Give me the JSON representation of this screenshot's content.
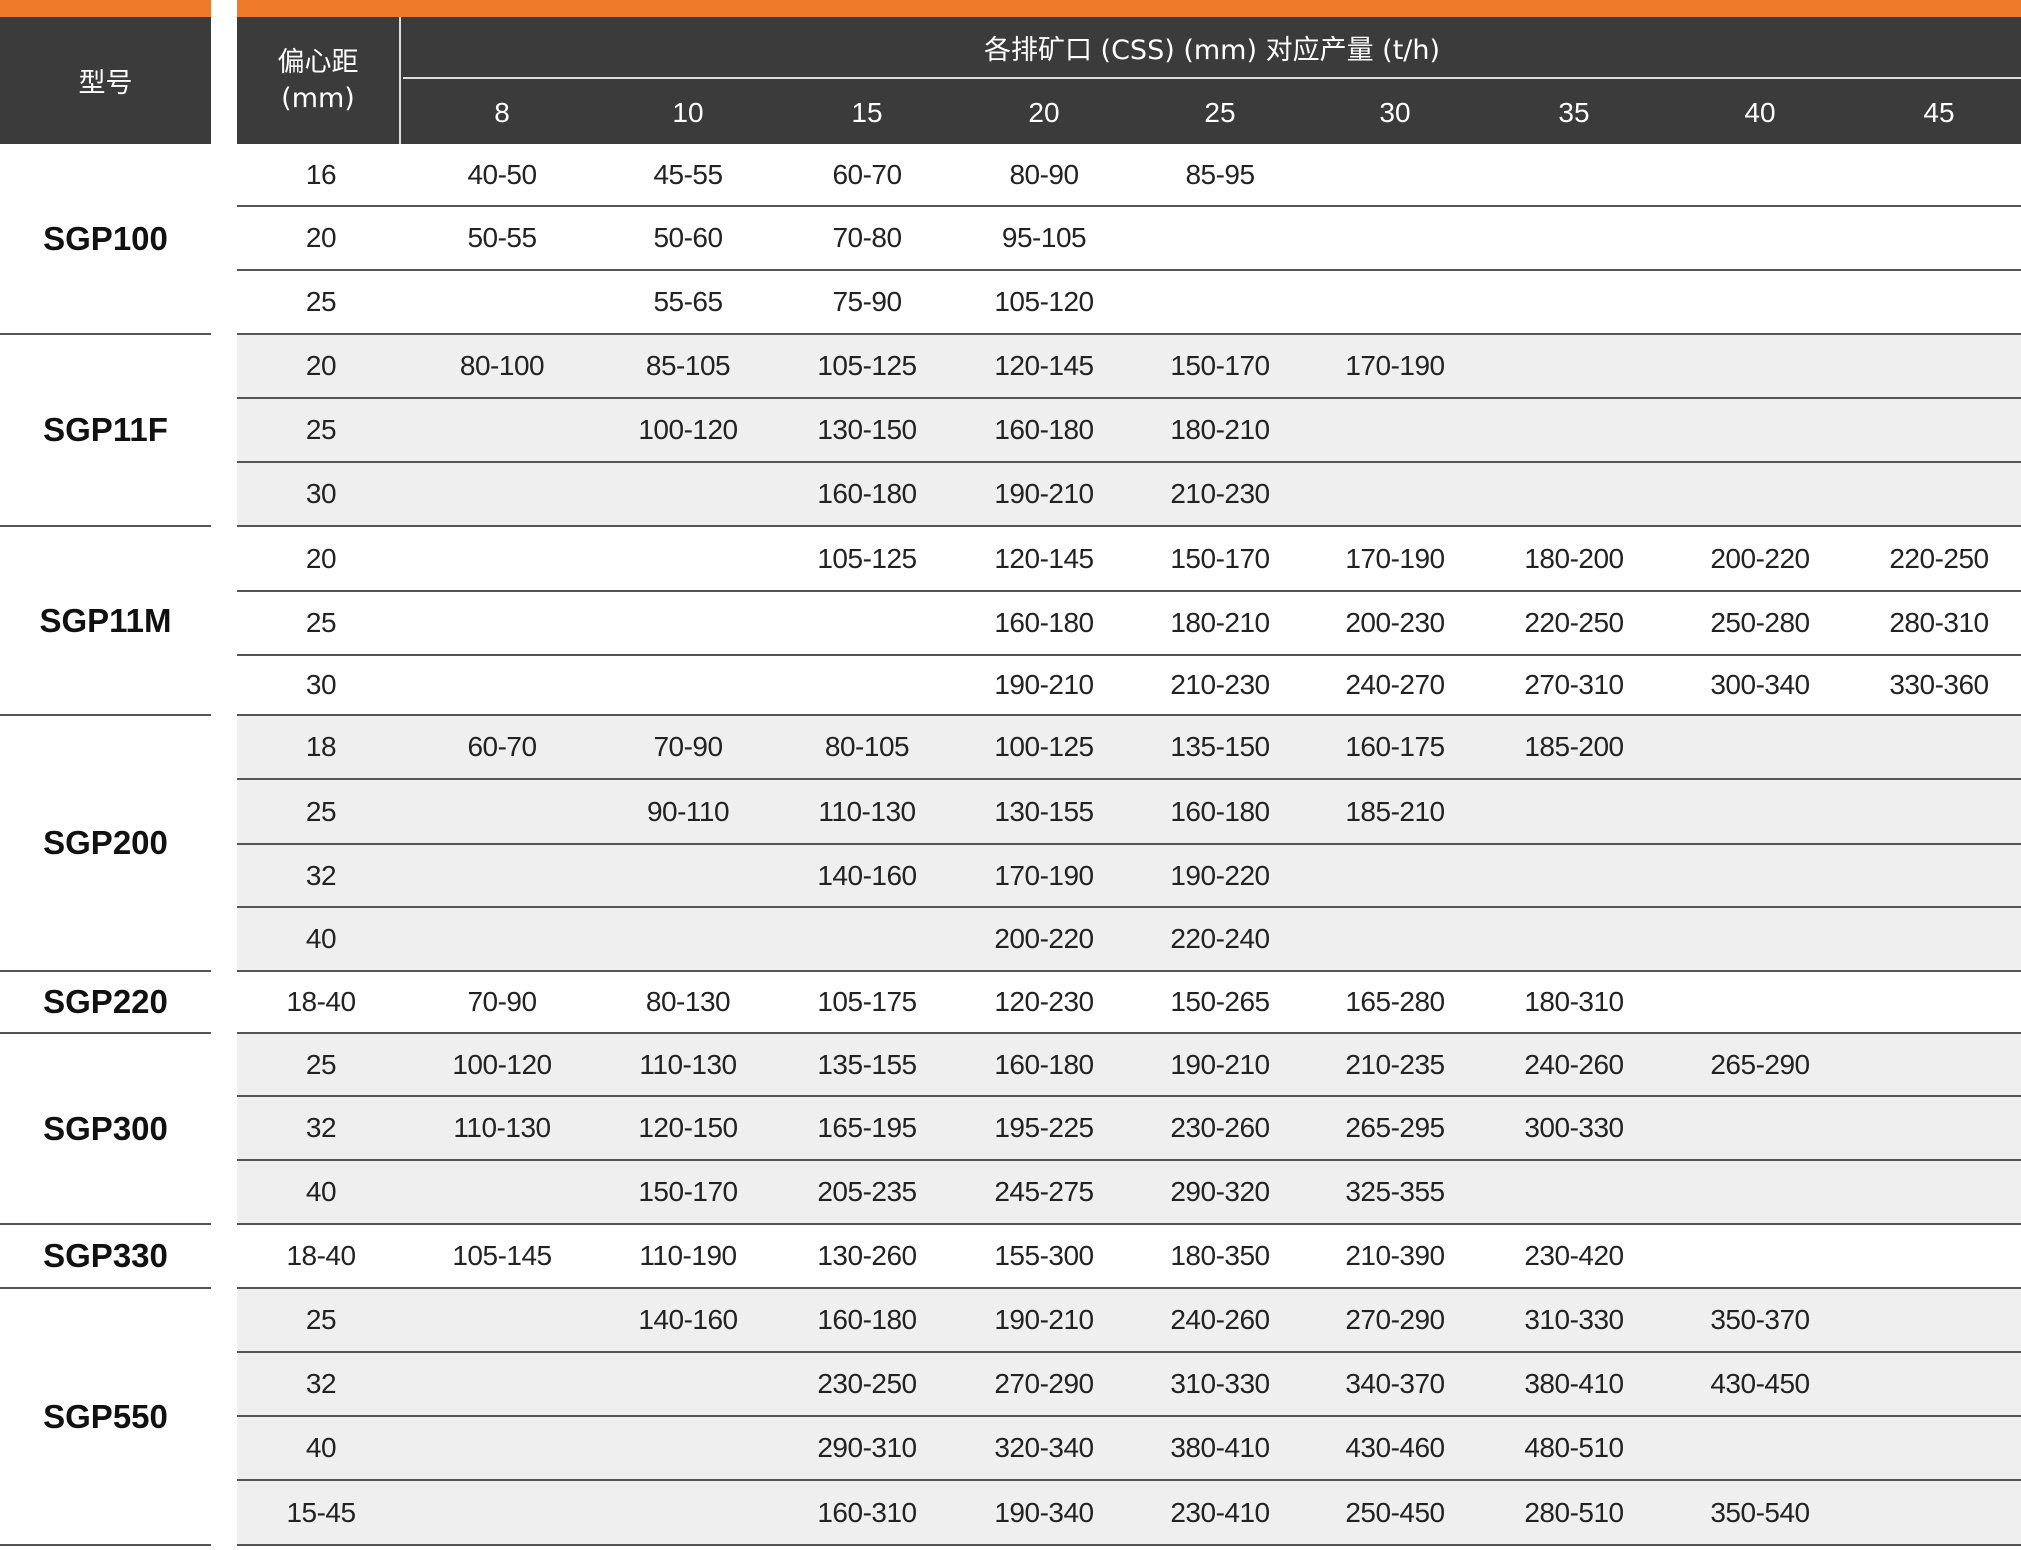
{
  "header": {
    "model_label": "型号",
    "ecc_label_1": "偏心距",
    "ecc_label_2": "(mm)",
    "span_label": "各排矿口 (CSS) (mm) 对应产量 (t/h)",
    "css_values": [
      "8",
      "10",
      "15",
      "20",
      "25",
      "30",
      "35",
      "40",
      "45"
    ]
  },
  "colors": {
    "accent": "#ee7a2a",
    "header_bg": "#3b3b3b",
    "shade": "#efefef"
  },
  "groups": [
    {
      "model": "SGP100",
      "rows": [
        {
          "ecc": "16",
          "values": [
            "40-50",
            "45-55",
            "60-70",
            "80-90",
            "85-95",
            "",
            "",
            "",
            ""
          ]
        },
        {
          "ecc": "20",
          "values": [
            "50-55",
            "50-60",
            "70-80",
            "95-105",
            "",
            "",
            "",
            "",
            ""
          ]
        },
        {
          "ecc": "25",
          "values": [
            "",
            "55-65",
            "75-90",
            "105-120",
            "",
            "",
            "",
            "",
            ""
          ]
        }
      ]
    },
    {
      "model": "SGP11F",
      "rows": [
        {
          "ecc": "20",
          "values": [
            "80-100",
            "85-105",
            "105-125",
            "120-145",
            "150-170",
            "170-190",
            "",
            "",
            ""
          ]
        },
        {
          "ecc": "25",
          "values": [
            "",
            "100-120",
            "130-150",
            "160-180",
            "180-210",
            "",
            "",
            "",
            ""
          ]
        },
        {
          "ecc": "30",
          "values": [
            "",
            "",
            "160-180",
            "190-210",
            "210-230",
            "",
            "",
            "",
            ""
          ]
        }
      ]
    },
    {
      "model": "SGP11M",
      "rows": [
        {
          "ecc": "20",
          "values": [
            "",
            "",
            "105-125",
            "120-145",
            "150-170",
            "170-190",
            "180-200",
            "200-220",
            "220-250"
          ]
        },
        {
          "ecc": "25",
          "values": [
            "",
            "",
            "",
            "160-180",
            "180-210",
            "200-230",
            "220-250",
            "250-280",
            "280-310"
          ]
        },
        {
          "ecc": "30",
          "values": [
            "",
            "",
            "",
            "190-210",
            "210-230",
            "240-270",
            "270-310",
            "300-340",
            "330-360"
          ]
        }
      ]
    },
    {
      "model": "SGP200",
      "rows": [
        {
          "ecc": "18",
          "values": [
            "60-70",
            "70-90",
            "80-105",
            "100-125",
            "135-150",
            "160-175",
            "185-200",
            "",
            ""
          ]
        },
        {
          "ecc": "25",
          "values": [
            "",
            "90-110",
            "110-130",
            "130-155",
            "160-180",
            "185-210",
            "",
            "",
            ""
          ]
        },
        {
          "ecc": "32",
          "values": [
            "",
            "",
            "140-160",
            "170-190",
            "190-220",
            "",
            "",
            "",
            ""
          ]
        },
        {
          "ecc": "40",
          "values": [
            "",
            "",
            "",
            "200-220",
            "220-240",
            "",
            "",
            "",
            ""
          ]
        }
      ]
    },
    {
      "model": "SGP220",
      "rows": [
        {
          "ecc": "18-40",
          "values": [
            "70-90",
            "80-130",
            "105-175",
            "120-230",
            "150-265",
            "165-280",
            "180-310",
            "",
            ""
          ]
        }
      ]
    },
    {
      "model": "SGP300",
      "rows": [
        {
          "ecc": "25",
          "values": [
            "100-120",
            "110-130",
            "135-155",
            "160-180",
            "190-210",
            "210-235",
            "240-260",
            "265-290",
            ""
          ]
        },
        {
          "ecc": "32",
          "values": [
            "110-130",
            "120-150",
            "165-195",
            "195-225",
            "230-260",
            "265-295",
            "300-330",
            "",
            ""
          ]
        },
        {
          "ecc": "40",
          "values": [
            "",
            "150-170",
            "205-235",
            "245-275",
            "290-320",
            "325-355",
            "",
            "",
            ""
          ]
        }
      ]
    },
    {
      "model": "SGP330",
      "rows": [
        {
          "ecc": "18-40",
          "values": [
            "105-145",
            "110-190",
            "130-260",
            "155-300",
            "180-350",
            "210-390",
            "230-420",
            "",
            ""
          ]
        }
      ]
    },
    {
      "model": "SGP550",
      "rows": [
        {
          "ecc": "25",
          "values": [
            "",
            "140-160",
            "160-180",
            "190-210",
            "240-260",
            "270-290",
            "310-330",
            "350-370",
            ""
          ]
        },
        {
          "ecc": "32",
          "values": [
            "",
            "",
            "230-250",
            "270-290",
            "310-330",
            "340-370",
            "380-410",
            "430-450",
            ""
          ]
        },
        {
          "ecc": "40",
          "values": [
            "",
            "",
            "290-310",
            "320-340",
            "380-410",
            "430-460",
            "480-510",
            "",
            ""
          ]
        },
        {
          "ecc": "15-45",
          "values": [
            "",
            "",
            "160-310",
            "190-340",
            "230-410",
            "250-450",
            "280-510",
            "350-540",
            ""
          ]
        }
      ]
    }
  ]
}
